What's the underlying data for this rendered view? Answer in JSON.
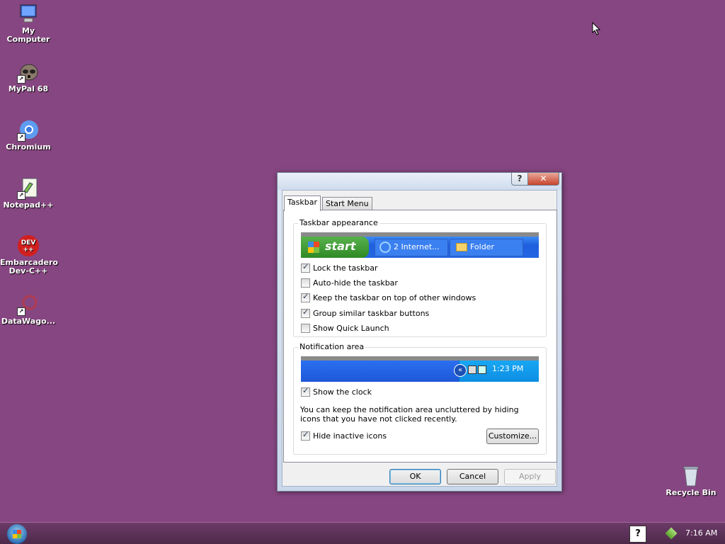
{
  "desktop": {
    "icons": [
      {
        "label": "My Computer"
      },
      {
        "label": "MyPal 68"
      },
      {
        "label": "Chromium"
      },
      {
        "label": "Notepad++"
      },
      {
        "label": "Embarcadero\nDev-C++"
      },
      {
        "label": "DataWago..."
      }
    ],
    "recycle_bin": "Recycle Bin"
  },
  "dialog": {
    "title_help": "?",
    "title_close": "✕",
    "tabs": [
      "Taskbar",
      "Start Menu"
    ],
    "taskbar_appearance": {
      "label": "Taskbar appearance",
      "preview": {
        "start": "start",
        "items": [
          "2 Internet...",
          "Folder"
        ]
      },
      "options": [
        {
          "label": "Lock the taskbar",
          "checked": true
        },
        {
          "label": "Auto-hide the taskbar",
          "checked": false
        },
        {
          "label": "Keep the taskbar on top of other windows",
          "checked": true
        },
        {
          "label": "Group similar taskbar buttons",
          "checked": true
        },
        {
          "label": "Show Quick Launch",
          "checked": false
        }
      ]
    },
    "notification_area": {
      "label": "Notification area",
      "preview_time": "1:23 PM",
      "show_clock": {
        "label": "Show the clock",
        "checked": true
      },
      "description": "You can keep the notification area uncluttered by hiding icons that you have not clicked recently.",
      "hide_inactive": {
        "label": "Hide inactive icons",
        "checked": true
      },
      "customize": "Customize..."
    },
    "buttons": {
      "ok": "OK",
      "cancel": "Cancel",
      "apply": "Apply"
    }
  },
  "taskbar": {
    "help_icon": "?",
    "time": "7:16 AM"
  }
}
